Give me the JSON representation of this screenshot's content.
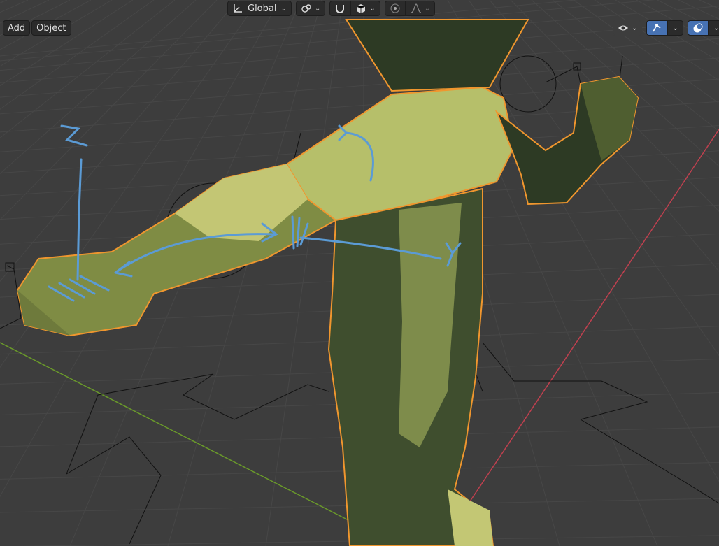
{
  "header": {
    "add_label": "Add",
    "object_label": "Object",
    "transform_orientation": "Global"
  },
  "annotations": {
    "z_label": "Z",
    "y_label": "Y"
  },
  "icons": {
    "orientation": "transform-orientation-icon",
    "pivot": "pivot-point-icon",
    "snap": "snap-magnet-icon",
    "snap_target": "snap-cube-icon",
    "proportional": "proportional-editing-icon",
    "falloff": "falloff-curve-icon",
    "visibility": "visibility-eye-icon",
    "gizmo": "gizmo-icon",
    "overlay": "overlay-icon"
  },
  "colors": {
    "background": "#3d3d3d",
    "selection_outline": "#f0962e",
    "annotation": "#5b9bd5",
    "x_axis": "#c0404f",
    "y_axis": "#6a9a2a",
    "mesh": "#8c9a4a"
  }
}
